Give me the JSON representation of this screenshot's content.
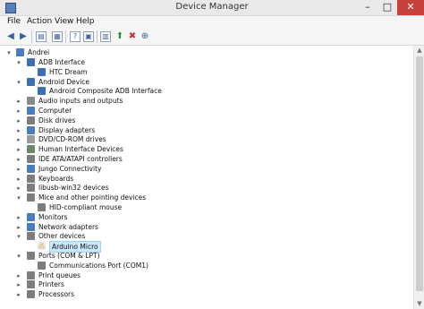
{
  "window": {
    "title": "Device Manager",
    "min": "–",
    "max": "□",
    "close": "✕"
  },
  "menu": [
    "File",
    "Action",
    "View",
    "Help"
  ],
  "toolbar": {
    "icons": [
      "back-icon",
      "forward-icon",
      "properties-icon",
      "show-hidden-icon",
      "help-icon",
      "view-icon",
      "update-driver-icon",
      "scan-hardware-icon",
      "uninstall-icon",
      "disable-icon"
    ]
  },
  "tree": {
    "root": "Andrei",
    "items": [
      {
        "label": "ADB Interface",
        "level": 1,
        "expander": "▾",
        "icon": "phone-icon",
        "color": "#3e6fb3"
      },
      {
        "label": "HTC Dream",
        "level": 2,
        "expander": "",
        "icon": "phone-icon",
        "color": "#3e6fb3"
      },
      {
        "label": "Android Device",
        "level": 1,
        "expander": "▾",
        "icon": "phone-icon",
        "color": "#3e6fb3"
      },
      {
        "label": "Android Composite ADB Interface",
        "level": 2,
        "expander": "",
        "icon": "phone-icon",
        "color": "#3e6fb3"
      },
      {
        "label": "Audio inputs and outputs",
        "level": 1,
        "expander": "▸",
        "icon": "speaker-icon",
        "color": "#8a8a8a"
      },
      {
        "label": "Computer",
        "level": 1,
        "expander": "▸",
        "icon": "computer-icon",
        "color": "#4a7cc0"
      },
      {
        "label": "Disk drives",
        "level": 1,
        "expander": "▸",
        "icon": "disk-icon",
        "color": "#7d7d7d"
      },
      {
        "label": "Display adapters",
        "level": 1,
        "expander": "▸",
        "icon": "display-icon",
        "color": "#4a7cc0"
      },
      {
        "label": "DVD/CD-ROM drives",
        "level": 1,
        "expander": "▸",
        "icon": "dvd-icon",
        "color": "#9a9a9a"
      },
      {
        "label": "Human Interface Devices",
        "level": 1,
        "expander": "▸",
        "icon": "hid-icon",
        "color": "#6a8a6a"
      },
      {
        "label": "IDE ATA/ATAPI controllers",
        "level": 1,
        "expander": "▸",
        "icon": "ide-icon",
        "color": "#7d7d7d"
      },
      {
        "label": "Jungo Connectivity",
        "level": 1,
        "expander": "▸",
        "icon": "device-icon",
        "color": "#4a7cc0"
      },
      {
        "label": "Keyboards",
        "level": 1,
        "expander": "▸",
        "icon": "keyboard-icon",
        "color": "#7d7d7d"
      },
      {
        "label": "libusb-win32 devices",
        "level": 1,
        "expander": "▸",
        "icon": "usb-icon",
        "color": "#7d7d7d"
      },
      {
        "label": "Mice and other pointing devices",
        "level": 1,
        "expander": "▾",
        "icon": "mouse-icon",
        "color": "#7d7d7d"
      },
      {
        "label": "HID-compliant mouse",
        "level": 2,
        "expander": "",
        "icon": "mouse-icon",
        "color": "#7d7d7d"
      },
      {
        "label": "Monitors",
        "level": 1,
        "expander": "▸",
        "icon": "monitor-icon",
        "color": "#4a7cc0"
      },
      {
        "label": "Network adapters",
        "level": 1,
        "expander": "▸",
        "icon": "network-icon",
        "color": "#4a7cc0"
      },
      {
        "label": "Other devices",
        "level": 1,
        "expander": "▾",
        "icon": "unknown-device-icon",
        "color": "#7d7d7d"
      },
      {
        "label": "Arduino Micro",
        "level": 2,
        "expander": "",
        "icon": "warning-icon",
        "color": "#d4a017",
        "selected": true
      },
      {
        "label": "Ports (COM & LPT)",
        "level": 1,
        "expander": "▾",
        "icon": "port-icon",
        "color": "#7d7d7d"
      },
      {
        "label": "Communications Port (COM1)",
        "level": 2,
        "expander": "",
        "icon": "port-icon",
        "color": "#7d7d7d"
      },
      {
        "label": "Print queues",
        "level": 1,
        "expander": "▸",
        "icon": "printer-icon",
        "color": "#7d7d7d"
      },
      {
        "label": "Printers",
        "level": 1,
        "expander": "▸",
        "icon": "printer-icon",
        "color": "#7d7d7d"
      },
      {
        "label": "Processors",
        "level": 1,
        "expander": "▸",
        "icon": "processor-icon",
        "color": "#7d7d7d"
      }
    ]
  },
  "scrollbar": {
    "up": "▲",
    "down": "▼"
  }
}
